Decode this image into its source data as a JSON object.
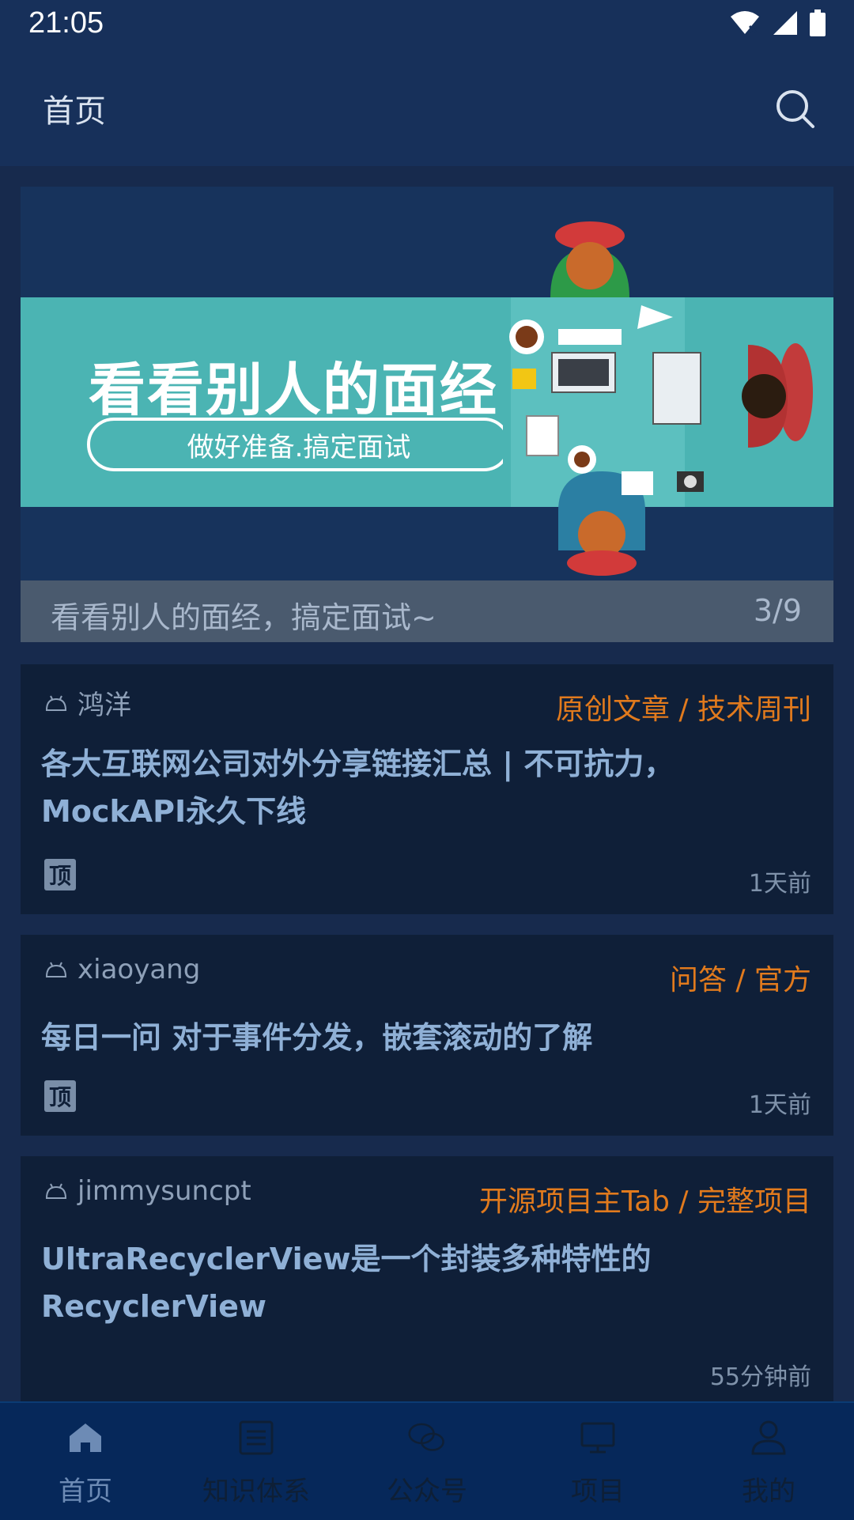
{
  "status_bar": {
    "time": "21:05"
  },
  "toolbar": {
    "title": "首页"
  },
  "banner": {
    "headline": "看看别人的面经",
    "subline": "做好准备.搞定面试",
    "caption": "看看别人的面经，搞定面试~",
    "indicator": "3/9"
  },
  "articles": [
    {
      "author": "鸿洋",
      "tags": "原创文章 / 技术周刊",
      "title_line1": "各大互联网公司对外分享链接汇总 | 不可抗力，",
      "title_line2": "MockAPI永久下线",
      "badge": "顶",
      "time": "1天前"
    },
    {
      "author": "xiaoyang",
      "tags": "问答 / 官方",
      "title_line1": "每日一问 对于事件分发，嵌套滚动的了解",
      "badge": "顶",
      "time": "1天前"
    },
    {
      "author": "jimmysuncpt",
      "tags": "开源项目主Tab / 完整项目",
      "title_line1": "UltraRecyclerView是一个封装多种特性的",
      "title_line2": "RecyclerView",
      "time": "55分钟前"
    }
  ],
  "bottom_nav": [
    {
      "label": "首页",
      "icon": "home-icon",
      "active": true
    },
    {
      "label": "知识体系",
      "icon": "list-icon"
    },
    {
      "label": "公众号",
      "icon": "wechat-icon"
    },
    {
      "label": "项目",
      "icon": "monitor-icon"
    },
    {
      "label": "我的",
      "icon": "person-icon"
    }
  ],
  "colors": {
    "accent_tag": "#e17a1d",
    "title": "#8fb0d6",
    "teal": "#4bb4b3"
  }
}
